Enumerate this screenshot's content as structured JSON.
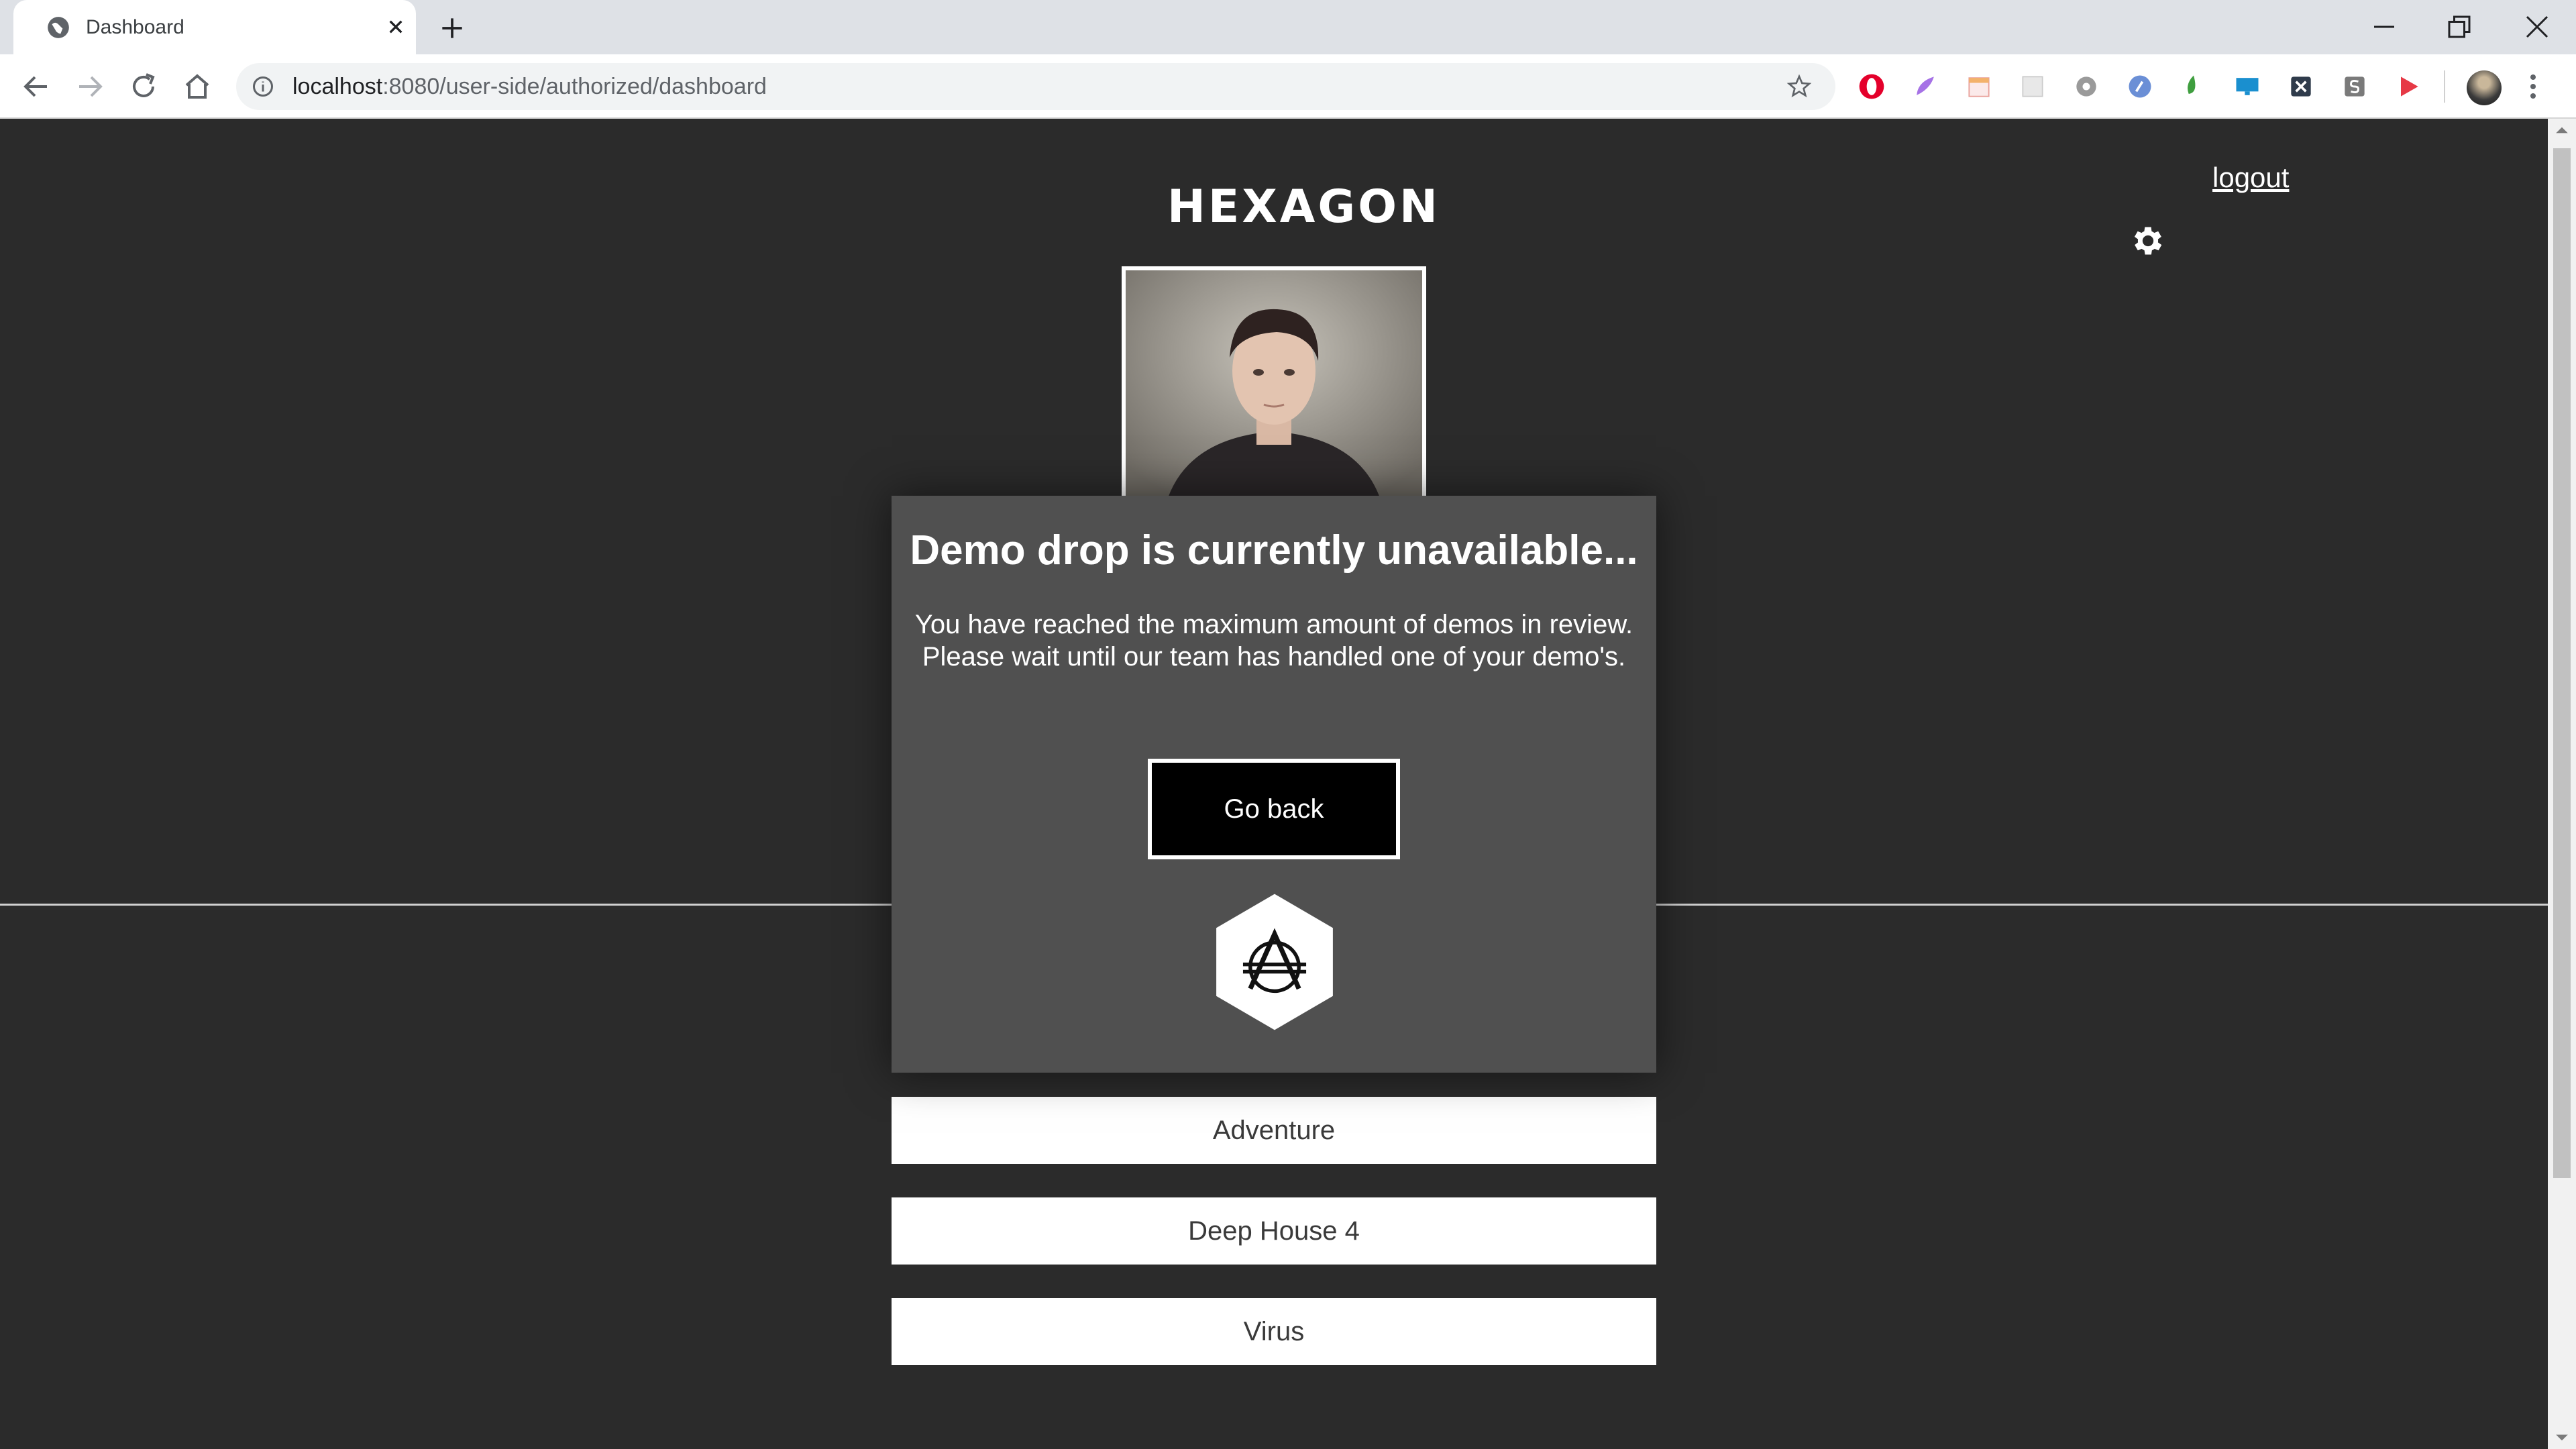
{
  "browser": {
    "tab_title": "Dashboard",
    "url_host": "localhost",
    "url_rest": ":8080/user-side/authorized/dashboard"
  },
  "header": {
    "logo_text": "HEXAGON",
    "logout_label": "logout"
  },
  "modal": {
    "title": "Demo drop is currently unavailable...",
    "line1": "You have reached the maximum amount of demos in review.",
    "line2": "Please wait until our team has handled one of your demo's.",
    "button_label": "Go back"
  },
  "demos": [
    {
      "title": "Adventure"
    },
    {
      "title": "Deep House 4"
    },
    {
      "title": "Virus"
    }
  ],
  "colors": {
    "page_bg": "#2b2b2b",
    "modal_bg": "#505050",
    "button_bg": "#000000",
    "text": "#ffffff"
  }
}
